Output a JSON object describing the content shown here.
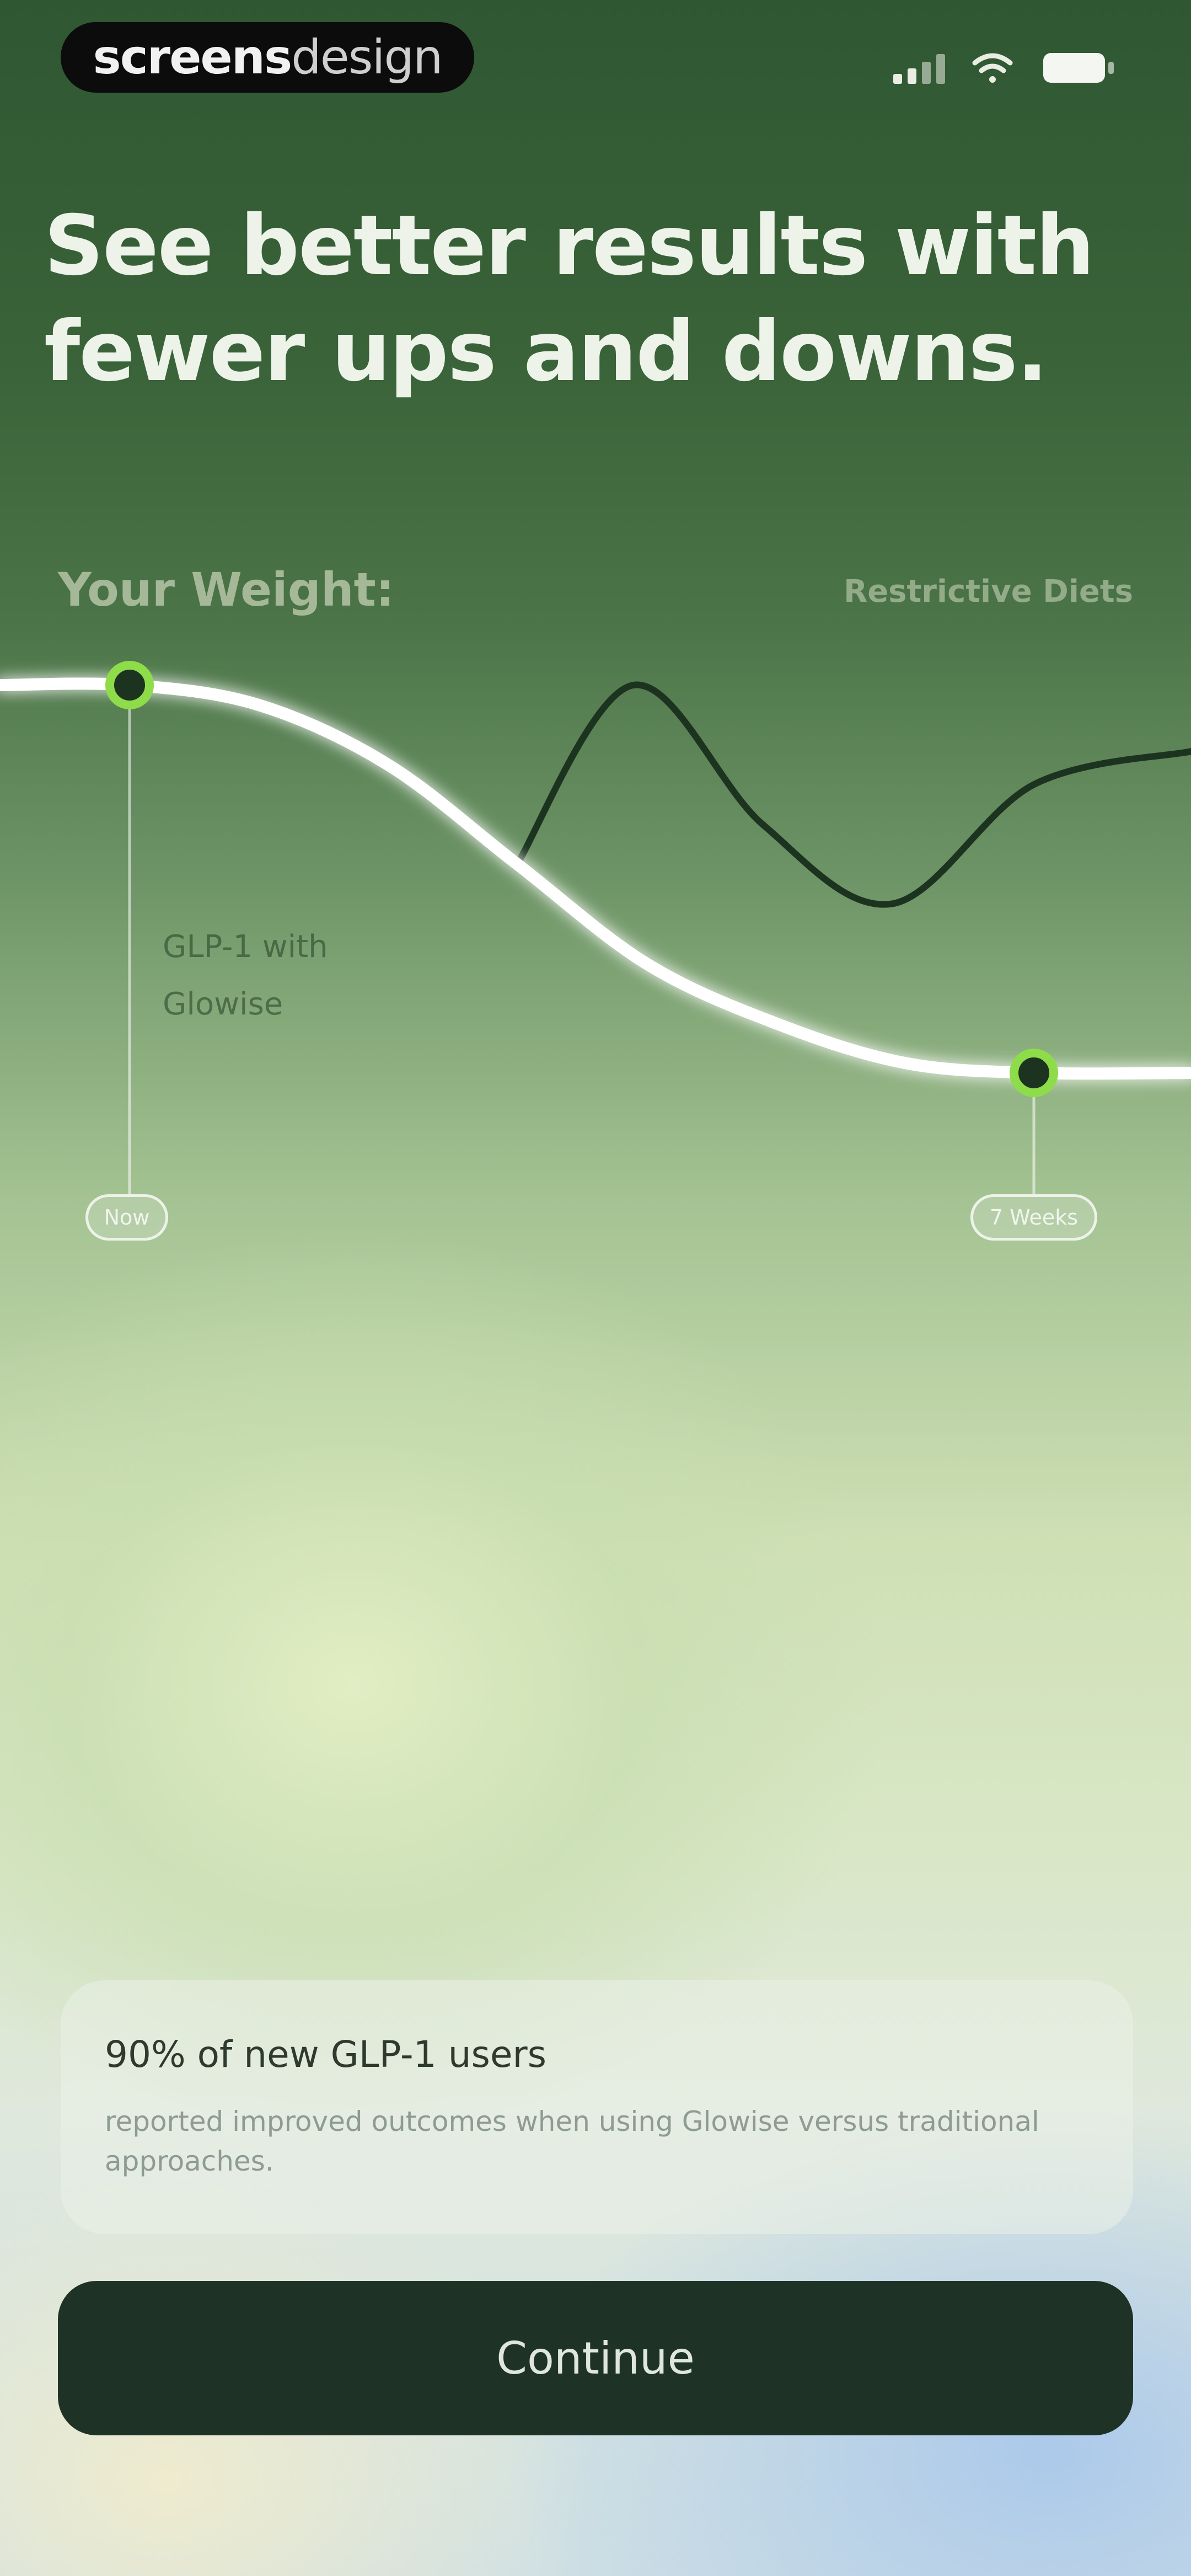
{
  "status_bar": {
    "brand_bold": "screens",
    "brand_light": "design",
    "icons": [
      "signal-icon",
      "wifi-icon",
      "battery-icon"
    ]
  },
  "headline": "See better results with fewer ups and downs.",
  "chart": {
    "title": "Your Weight:",
    "restrictive_label": "Restrictive Diets",
    "glowise_label": "GLP-1 with Glowise",
    "tick_start": "Now",
    "tick_end": "7 Weeks"
  },
  "chart_data": {
    "type": "line",
    "series": [
      {
        "name": "GLP-1 with Glowise",
        "x": [
          0,
          1,
          2,
          3,
          4,
          5,
          6,
          7
        ],
        "values": [
          100,
          99,
          96,
          91,
          86,
          83,
          81,
          80.5
        ]
      },
      {
        "name": "Restrictive Diets",
        "x": [
          3.0,
          3.9,
          4.9,
          5.9,
          7.0
        ],
        "values": [
          91,
          100,
          93,
          89,
          95
        ]
      }
    ],
    "markers": [
      {
        "x": 0,
        "value": 100
      },
      {
        "x": 7,
        "value": 80.5
      }
    ],
    "xlabel": "",
    "ylabel": "",
    "grid": false,
    "colors": {
      "glowise": "#ffffff",
      "restrictive": "#1c3320",
      "marker": "#8fdc4a"
    }
  },
  "stat_card": {
    "headline": "90% of new GLP-1 users",
    "body": "reported improved outcomes when using Glowise versus traditional approaches."
  },
  "continue_label": "Continue",
  "colors": {
    "accent_green": "#8fdc4a",
    "button_bg": "#1e3326",
    "top_bg": "#2f5732"
  }
}
